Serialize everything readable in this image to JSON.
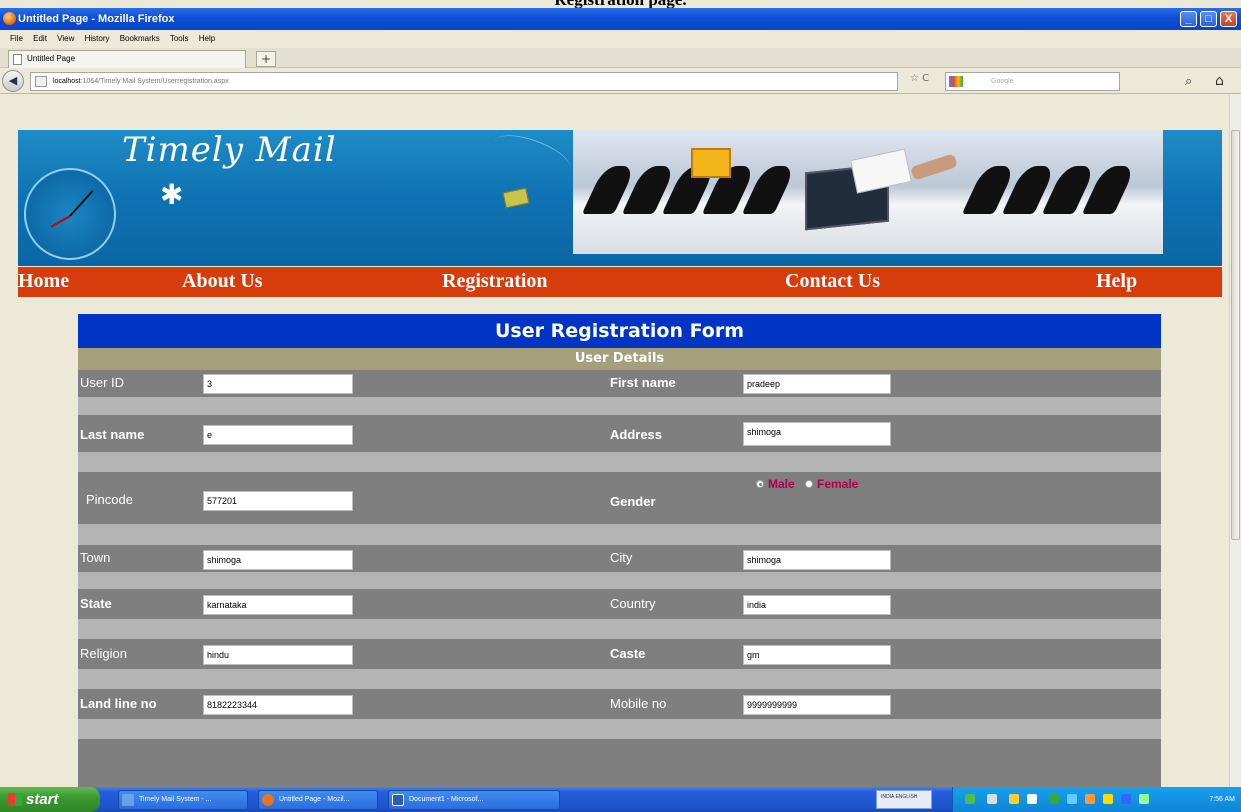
{
  "caption": "Registration page.",
  "window": {
    "title": "Untitled Page - Mozilla Firefox",
    "controls": {
      "minimize": "_",
      "maximize": "□",
      "close": "X"
    }
  },
  "menu": [
    "File",
    "Edit",
    "View",
    "History",
    "Bookmarks",
    "Tools",
    "Help"
  ],
  "tab": {
    "title": "Untitled Page",
    "new_tab": "+"
  },
  "nav": {
    "url_host": "localhost",
    "url_rest": ":1064/Timely Mail System/Userregistration.aspx",
    "search_placeholder": "Google",
    "back": "◀",
    "star": "☆",
    "reload": "C",
    "magnifier": "⌕",
    "home": "⌂"
  },
  "banner": {
    "title": "Timely Mail",
    "star": "✱"
  },
  "site_nav": [
    "Home",
    "About Us",
    "Registration",
    "Contact Us",
    "Help"
  ],
  "form": {
    "title": "User Registration Form",
    "section": "User Details",
    "rows": [
      {
        "left_label": "User ID",
        "left_value": "3",
        "right_label": "First name",
        "right_value": "pradeep"
      },
      {
        "left_label": "Last name",
        "left_value": "e",
        "right_label": "Address",
        "right_value": "shimoga"
      },
      {
        "left_label": "Pincode",
        "left_value": "577201",
        "right_label": "Gender",
        "right_value": ""
      },
      {
        "left_label": "Town",
        "left_value": "shimoga",
        "right_label": "City",
        "right_value": "shimoga"
      },
      {
        "left_label": "State",
        "left_value": "karnataka",
        "right_label": "Country",
        "right_value": "india"
      },
      {
        "left_label": "Religion",
        "left_value": "hindu",
        "right_label": "Caste",
        "right_value": "gm"
      },
      {
        "left_label": "Land line no",
        "left_value": "8182223344",
        "right_label": "Mobile no",
        "right_value": "9999999999"
      }
    ],
    "gender_options": [
      "Male",
      "Female"
    ],
    "gender_selected": "Male"
  },
  "taskbar": {
    "start": "start",
    "items": [
      "Timely Mail System - ...",
      "Untitled Page - Mozil...",
      "Document1 - Microsof..."
    ],
    "lang": "INDIA ENGLISH",
    "clock": "7:56 AM",
    "colors": {
      "start": "#3c9b32",
      "bar": "#245edb"
    }
  },
  "colors": {
    "form_header": "#0034c4",
    "section_band": "#a5a07c",
    "nav_menu": "#d73c0c",
    "banner": "#1e8cc6",
    "radio_label": "#b00050"
  }
}
